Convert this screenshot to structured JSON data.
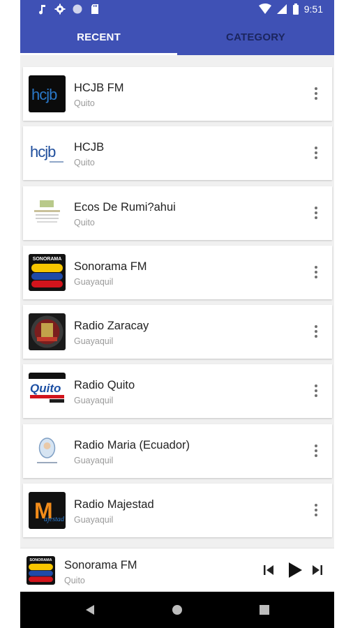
{
  "status_bar": {
    "time": "9:51",
    "left_icons": [
      "music-note-icon",
      "gear-icon",
      "circle-icon",
      "sd-card-icon"
    ],
    "right_icons": [
      "wifi-icon",
      "signal-icon",
      "battery-icon"
    ]
  },
  "tabs": [
    {
      "label": "RECENT",
      "active": true
    },
    {
      "label": "CATEGORY",
      "active": false
    }
  ],
  "stations": [
    {
      "name": "HCJB FM",
      "city": "Quito",
      "logo_text": "hcjb",
      "logo": "hcjb-fm-logo"
    },
    {
      "name": "HCJB",
      "city": "Quito",
      "logo_text": "hcjb",
      "logo": "hcjb-logo"
    },
    {
      "name": "Ecos De Rumi?ahui",
      "city": "Quito",
      "logo_text": "Rumiñahui",
      "logo": "ecos-rumiahui-logo"
    },
    {
      "name": "Sonorama FM",
      "city": "Guayaquil",
      "logo_text": "SONORAMA",
      "logo": "sonorama-logo"
    },
    {
      "name": "Radio Zaracay",
      "city": "Guayaquil",
      "logo_text": "",
      "logo": "zaracay-logo"
    },
    {
      "name": "Radio Quito",
      "city": "Guayaquil",
      "logo_text": "Quito",
      "logo": "radio-quito-logo"
    },
    {
      "name": "Radio Maria (Ecuador)",
      "city": "Guayaquil",
      "logo_text": "",
      "logo": "radio-maria-logo"
    },
    {
      "name": "Radio Majestad",
      "city": "Guayaquil",
      "logo_text": "M",
      "logo": "majestad-logo"
    }
  ],
  "player": {
    "name": "Sonorama FM",
    "city": "Quito",
    "logo_text": "SONORAMA",
    "controls": [
      "skip-previous-icon",
      "play-icon",
      "skip-next-icon"
    ]
  },
  "nav_bar": [
    "back-icon",
    "home-icon",
    "recents-icon"
  ],
  "colors": {
    "primary": "#3f51b5",
    "tab_inactive": "#1b255e",
    "background": "#f0f0f0"
  }
}
